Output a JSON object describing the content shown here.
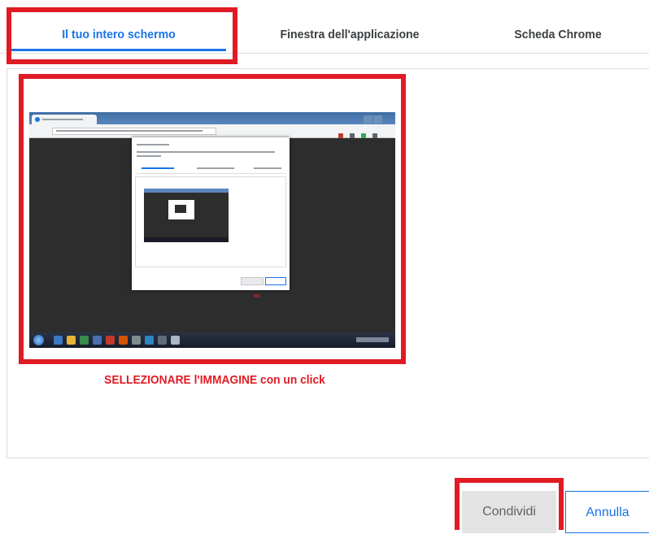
{
  "tabs": [
    {
      "label": "Il tuo intero schermo",
      "active": true
    },
    {
      "label": "Finestra dell'applicazione",
      "active": false
    },
    {
      "label": "Scheda Chrome",
      "active": false
    }
  ],
  "instruction": "SELLEZIONARE l'IMMAGINE con un click",
  "buttons": {
    "share": "Condividi",
    "cancel": "Annulla"
  },
  "colors": {
    "accent": "#1a73e8",
    "highlight": "#e01b24",
    "disabled_bg": "#e3e3e3"
  },
  "icons": [
    "chrome-favicon-icon",
    "windows-start-icon"
  ]
}
